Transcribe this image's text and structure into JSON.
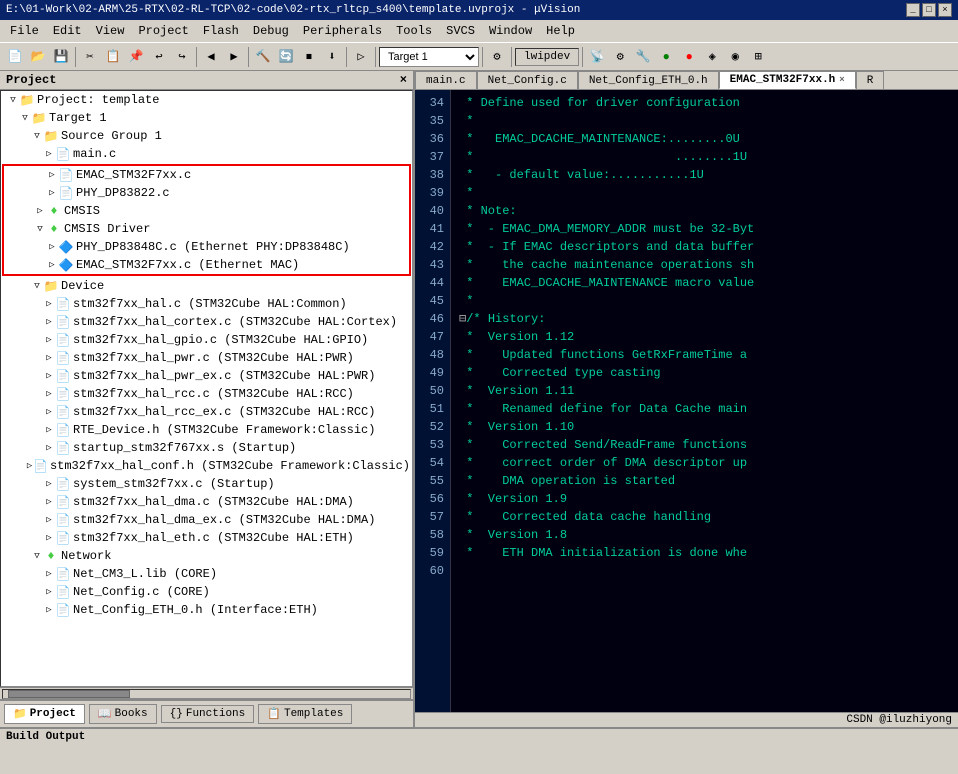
{
  "titleBar": {
    "text": "E:\\01-Work\\02-ARM\\25-RTX\\02-RL-TCP\\02-code\\02-rtx_rltcp_s400\\template.uvprojx - μVision",
    "controls": [
      "_",
      "□",
      "×"
    ]
  },
  "menuBar": {
    "items": [
      "File",
      "Edit",
      "View",
      "Project",
      "Flash",
      "Debug",
      "Peripherals",
      "Tools",
      "SVCS",
      "Window",
      "Help"
    ]
  },
  "toolbar1": {
    "targetName": "Target 1",
    "deviceLabel": "lwipdev"
  },
  "projectPanel": {
    "title": "Project",
    "closeBtn": "×",
    "rootLabel": "Project: template",
    "tree": [
      {
        "level": 0,
        "label": "Project: template",
        "type": "root",
        "expanded": true
      },
      {
        "level": 1,
        "label": "Target 1",
        "type": "folder",
        "expanded": true
      },
      {
        "level": 2,
        "label": "Source Group 1",
        "type": "folder",
        "expanded": true
      },
      {
        "level": 3,
        "label": "main.c",
        "type": "file",
        "inRedBorder": false
      },
      {
        "level": 3,
        "label": "EMAC_STM32F7xx.c",
        "type": "file",
        "inRedBorder": true
      },
      {
        "level": 3,
        "label": "PHY_DP83822.c",
        "type": "file",
        "inRedBorder": true
      },
      {
        "level": 2,
        "label": "CMSIS",
        "type": "gem",
        "expanded": false
      },
      {
        "level": 2,
        "label": "CMSIS Driver",
        "type": "gem",
        "expanded": true
      },
      {
        "level": 3,
        "label": "PHY_DP83848C.c (Ethernet PHY:DP83848C)",
        "type": "chip",
        "inRedBorder": true
      },
      {
        "level": 3,
        "label": "EMAC_STM32F7xx.c (Ethernet MAC)",
        "type": "chip",
        "inRedBorder": true
      },
      {
        "level": 2,
        "label": "Device",
        "type": "folder",
        "expanded": true
      },
      {
        "level": 3,
        "label": "stm32f7xx_hal.c (STM32Cube HAL:Common)",
        "type": "file"
      },
      {
        "level": 3,
        "label": "stm32f7xx_hal_cortex.c (STM32Cube HAL:Cortex)",
        "type": "file"
      },
      {
        "level": 3,
        "label": "stm32f7xx_hal_gpio.c (STM32Cube HAL:GPIO)",
        "type": "file"
      },
      {
        "level": 3,
        "label": "stm32f7xx_hal_pwr.c (STM32Cube HAL:PWR)",
        "type": "file"
      },
      {
        "level": 3,
        "label": "stm32f7xx_hal_pwr_ex.c (STM32Cube HAL:PWR)",
        "type": "file"
      },
      {
        "level": 3,
        "label": "stm32f7xx_hal_rcc.c (STM32Cube HAL:RCC)",
        "type": "file"
      },
      {
        "level": 3,
        "label": "stm32f7xx_hal_rcc_ex.c (STM32Cube HAL:RCC)",
        "type": "file"
      },
      {
        "level": 3,
        "label": "RTE_Device.h (STM32Cube Framework:Classic)",
        "type": "file"
      },
      {
        "level": 3,
        "label": "startup_stm32f767xx.s (Startup)",
        "type": "file"
      },
      {
        "level": 3,
        "label": "stm32f7xx_hal_conf.h (STM32Cube Framework:Classic)",
        "type": "file"
      },
      {
        "level": 3,
        "label": "system_stm32f7xx.c (Startup)",
        "type": "file"
      },
      {
        "level": 3,
        "label": "stm32f7xx_hal_dma.c (STM32Cube HAL:DMA)",
        "type": "file"
      },
      {
        "level": 3,
        "label": "stm32f7xx_hal_dma_ex.c (STM32Cube HAL:DMA)",
        "type": "file"
      },
      {
        "level": 3,
        "label": "stm32f7xx_hal_eth.c (STM32Cube HAL:ETH)",
        "type": "file"
      },
      {
        "level": 2,
        "label": "Network",
        "type": "gem",
        "expanded": true
      },
      {
        "level": 3,
        "label": "Net_CM3_L.lib (CORE)",
        "type": "file"
      },
      {
        "level": 3,
        "label": "Net_Config.c (CORE)",
        "type": "file"
      },
      {
        "level": 3,
        "label": "Net_Config_ETH_0.h (Interface:ETH)",
        "type": "file"
      }
    ]
  },
  "tabs": [
    {
      "label": "main.c",
      "active": false
    },
    {
      "label": "Net_Config.c",
      "active": false
    },
    {
      "label": "Net_Config_ETH_0.h",
      "active": false
    },
    {
      "label": "EMAC_STM32F7xx.h",
      "active": true
    },
    {
      "label": "R",
      "active": false
    }
  ],
  "codeLines": [
    {
      "num": 34,
      "text": " * Define used for driver configuration"
    },
    {
      "num": 35,
      "text": " *"
    },
    {
      "num": 36,
      "text": " *   EMAC_DCACHE_MAINTENANCE:........0U"
    },
    {
      "num": 37,
      "text": " *                            ........1U"
    },
    {
      "num": 38,
      "text": " *   - default value:...........1U"
    },
    {
      "num": 39,
      "text": " *"
    },
    {
      "num": 40,
      "text": " * Note:"
    },
    {
      "num": 41,
      "text": " *  - EMAC_DMA_MEMORY_ADDR must be 32-Byt"
    },
    {
      "num": 42,
      "text": " *  - If EMAC descriptors and data buffer"
    },
    {
      "num": 43,
      "text": " *    the cache maintenance operations sh"
    },
    {
      "num": 44,
      "text": " *    EMAC_DCACHE_MAINTENANCE macro value"
    },
    {
      "num": 45,
      "text": " *"
    },
    {
      "num": 46,
      "text": ""
    },
    {
      "num": 47,
      "text": "/* History:",
      "collapse": true
    },
    {
      "num": 48,
      "text": " *  Version 1.12"
    },
    {
      "num": 49,
      "text": " *    Updated functions GetRxFrameTime a"
    },
    {
      "num": 50,
      "text": " *    Corrected type casting"
    },
    {
      "num": 51,
      "text": " *  Version 1.11"
    },
    {
      "num": 52,
      "text": " *    Renamed define for Data Cache main"
    },
    {
      "num": 53,
      "text": " *  Version 1.10"
    },
    {
      "num": 54,
      "text": " *    Corrected Send/ReadFrame functions"
    },
    {
      "num": 55,
      "text": " *    correct order of DMA descriptor up"
    },
    {
      "num": 56,
      "text": " *    DMA operation is started"
    },
    {
      "num": 57,
      "text": " *  Version 1.9"
    },
    {
      "num": 58,
      "text": " *    Corrected data cache handling"
    },
    {
      "num": 59,
      "text": " *  Version 1.8"
    },
    {
      "num": 60,
      "text": " *    ETH DMA initialization is done whe"
    }
  ],
  "bottomTabs": [
    {
      "label": "Project",
      "icon": "📁",
      "active": true
    },
    {
      "label": "Books",
      "icon": "📖",
      "active": false
    },
    {
      "label": "Functions",
      "icon": "{}",
      "active": false
    },
    {
      "label": "Templates",
      "icon": "📋",
      "active": false
    }
  ],
  "buildOutput": {
    "label": "Build Output"
  },
  "statusBar": {
    "text": "CSDN @iluzhiyong"
  }
}
